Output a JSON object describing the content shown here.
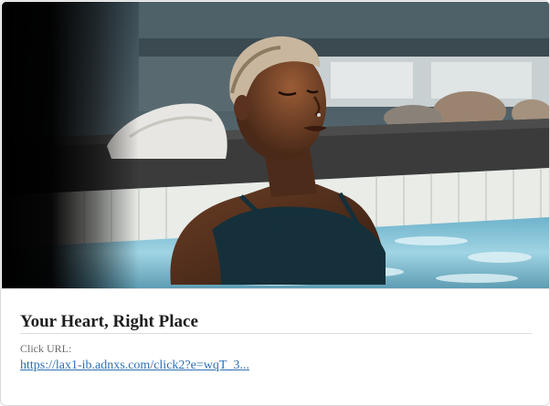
{
  "card": {
    "image_alt": "Woman relaxing with eyes closed in an outdoor hot tub",
    "title": "Your Heart, Right Place",
    "url_label": "Click URL:",
    "url_text": "https://lax1-ib.adnxs.com/click2?e=wqT_3..."
  }
}
